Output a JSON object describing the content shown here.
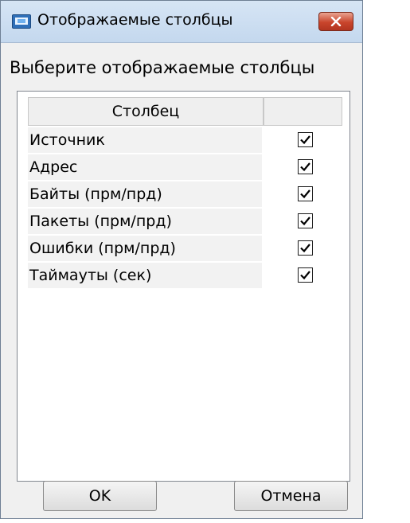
{
  "window": {
    "title": "Отображаемые столбцы",
    "close_icon": "close-icon",
    "app_icon": "network-monitor-icon"
  },
  "prompt": "Выберите отображаемые столбцы",
  "table": {
    "headers": [
      "Столбец",
      ""
    ],
    "rows": [
      {
        "label": "Источник",
        "checked": true
      },
      {
        "label": "Адрес",
        "checked": true
      },
      {
        "label": "Байты (прм/прд)",
        "checked": true
      },
      {
        "label": "Пакеты (прм/прд)",
        "checked": true
      },
      {
        "label": "Ошибки (прм/прд)",
        "checked": true
      },
      {
        "label": "Таймауты (сек)",
        "checked": true
      }
    ]
  },
  "buttons": {
    "ok": "OK",
    "cancel": "Отмена"
  },
  "colors": {
    "titlebar": "#c4d8ee",
    "close_button": "#c9452c",
    "window_bg": "#f0f0f0"
  }
}
